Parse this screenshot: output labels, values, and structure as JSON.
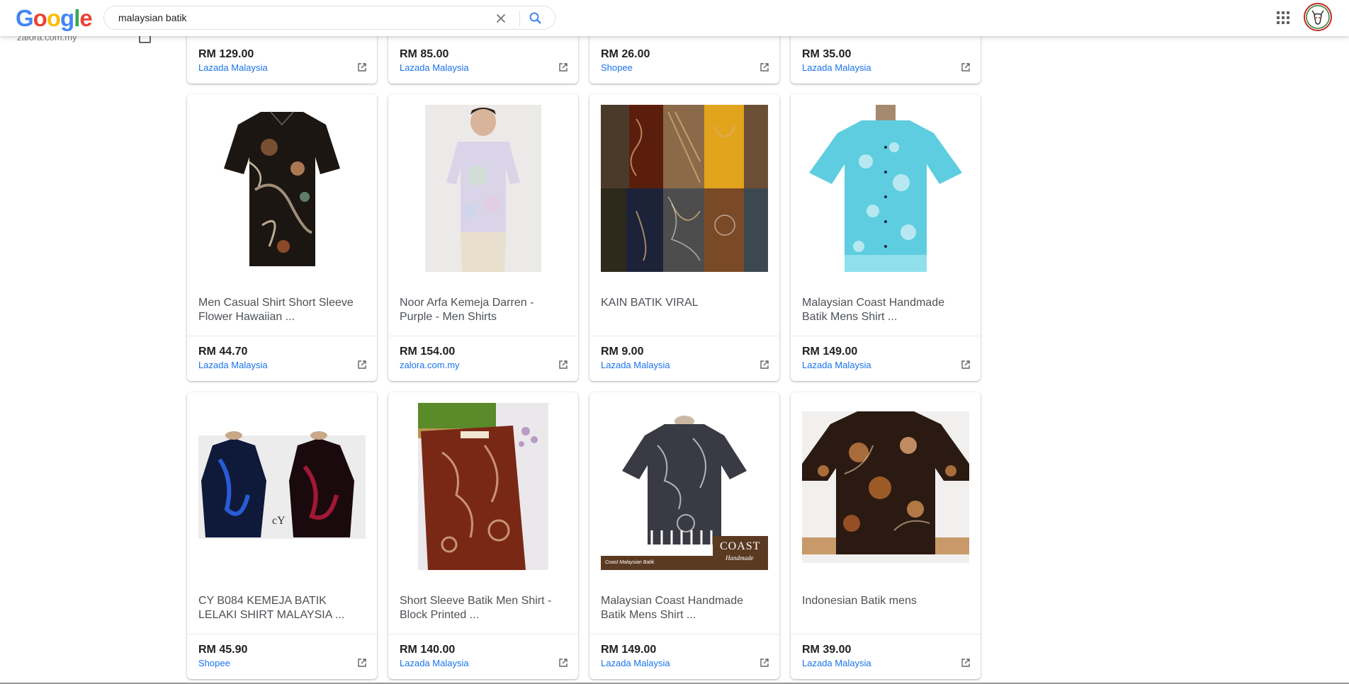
{
  "header": {
    "logo_letters": [
      {
        "ch": "G",
        "color": "#4285f4"
      },
      {
        "ch": "o",
        "color": "#ea4335"
      },
      {
        "ch": "o",
        "color": "#fbbc05"
      },
      {
        "ch": "g",
        "color": "#4285f4"
      },
      {
        "ch": "l",
        "color": "#34a853"
      },
      {
        "ch": "e",
        "color": "#ea4335"
      }
    ],
    "search_value": "malaysian batik",
    "icons": {
      "clear": "close-icon",
      "search": "search-icon",
      "apps": "apps-grid-icon",
      "avatar": "profile-avatar"
    }
  },
  "sidebar": {
    "filter_label": "zalora.com.my"
  },
  "top_row": [
    {
      "price": "RM 129.00",
      "seller": "Lazada Malaysia"
    },
    {
      "price": "RM 85.00",
      "seller": "Lazada Malaysia"
    },
    {
      "price": "RM 26.00",
      "seller": "Shopee"
    },
    {
      "price": "RM 35.00",
      "seller": "Lazada Malaysia"
    }
  ],
  "row2": [
    {
      "title": "Men Casual Shirt Short Sleeve Flower Hawaiian ...",
      "price": "RM 44.70",
      "seller": "Lazada Malaysia"
    },
    {
      "title": "Noor Arfa Kemeja Darren - Purple - Men Shirts",
      "price": "RM 154.00",
      "seller": "zalora.com.my"
    },
    {
      "title": "KAIN BATIK VIRAL",
      "price": "RM 9.00",
      "seller": "Lazada Malaysia"
    },
    {
      "title": "Malaysian Coast Handmade Batik Mens Shirt ...",
      "price": "RM 149.00",
      "seller": "Lazada Malaysia"
    }
  ],
  "row3": [
    {
      "title": "CY B084 KEMEJA BATIK LELAKI SHIRT MALAYSIA ...",
      "price": "RM 45.90",
      "seller": "Shopee"
    },
    {
      "title": "Short Sleeve Batik Men Shirt - Block Printed ...",
      "price": "RM 140.00",
      "seller": "Lazada Malaysia"
    },
    {
      "title": "Malaysian Coast Handmade Batik Mens Shirt ...",
      "price": "RM 149.00",
      "seller": "Lazada Malaysia"
    },
    {
      "title": "Indonesian Batik mens",
      "price": "RM 39.00",
      "seller": "Lazada Malaysia"
    }
  ],
  "image_overlays": {
    "cy_logo": "cY",
    "coast_banner": "Coast Malaysian Batik",
    "coast_logo": "COAST",
    "coast_sub": "Handmade"
  }
}
